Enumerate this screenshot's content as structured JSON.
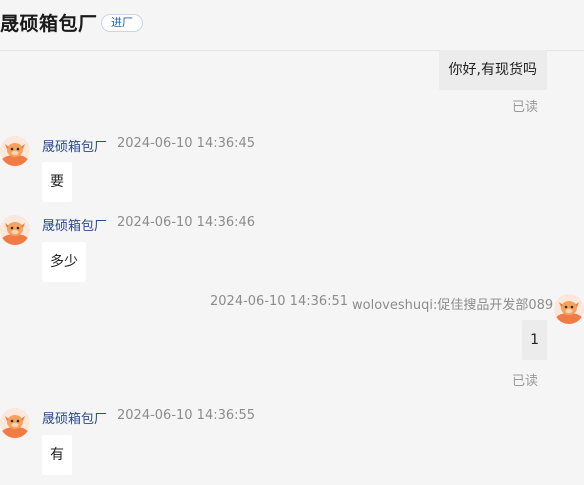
{
  "header": {
    "title": "晟硕箱包厂",
    "tag": "进厂"
  },
  "messages": [
    {
      "text": "你好,有现货吗",
      "status": "已读"
    },
    {
      "sender": "晟硕箱包厂",
      "time": "2024-06-10 14:36:45",
      "text": "要"
    },
    {
      "sender": "晟硕箱包厂",
      "time": "2024-06-10 14:36:46",
      "text": "多少"
    },
    {
      "sender": "woloveshuqi:促佳搜品开发部089",
      "time": "2024-06-10 14:36:51",
      "text": "1",
      "status": "已读"
    },
    {
      "sender": "晟硕箱包厂",
      "time": "2024-06-10 14:36:55",
      "text": "有"
    }
  ],
  "colors": {
    "accent": "#2b4a8f",
    "avatar": "#f27a45"
  },
  "icons": {
    "avatar": "cow-mascot-icon"
  }
}
